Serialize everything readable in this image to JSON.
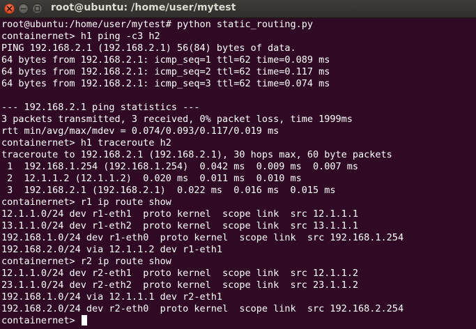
{
  "window": {
    "title": "root@ubuntu: /home/user/mytest"
  },
  "titlebar_icons": [
    "close-icon",
    "minimize-icon",
    "maximize-icon"
  ],
  "colors": {
    "terminal_background": "#300a24",
    "terminal_text": "#ffffff",
    "titlebar": "#3c3b37",
    "title_text": "#dfdbd2",
    "close_button": "#e2522b"
  },
  "terminal": {
    "lines": [
      "root@ubuntu:/home/user/mytest# python static_routing.py",
      "containernet> h1 ping -c3 h2",
      "PING 192.168.2.1 (192.168.2.1) 56(84) bytes of data.",
      "64 bytes from 192.168.2.1: icmp_seq=1 ttl=62 time=0.089 ms",
      "64 bytes from 192.168.2.1: icmp_seq=2 ttl=62 time=0.117 ms",
      "64 bytes from 192.168.2.1: icmp_seq=3 ttl=62 time=0.074 ms",
      "",
      "--- 192.168.2.1 ping statistics ---",
      "3 packets transmitted, 3 received, 0% packet loss, time 1999ms",
      "rtt min/avg/max/mdev = 0.074/0.093/0.117/0.019 ms",
      "containernet> h1 traceroute h2",
      "traceroute to 192.168.2.1 (192.168.2.1), 30 hops max, 60 byte packets",
      " 1  192.168.1.254 (192.168.1.254)  0.042 ms  0.009 ms  0.007 ms",
      " 2  12.1.1.2 (12.1.1.2)  0.020 ms  0.011 ms  0.010 ms",
      " 3  192.168.2.1 (192.168.2.1)  0.022 ms  0.016 ms  0.015 ms",
      "containernet> r1 ip route show",
      "12.1.1.0/24 dev r1-eth1  proto kernel  scope link  src 12.1.1.1",
      "13.1.1.0/24 dev r1-eth2  proto kernel  scope link  src 13.1.1.1",
      "192.168.1.0/24 dev r1-eth0  proto kernel  scope link  src 192.168.1.254",
      "192.168.2.0/24 via 12.1.1.2 dev r1-eth1",
      "containernet> r2 ip route show",
      "12.1.1.0/24 dev r2-eth1  proto kernel  scope link  src 12.1.1.2",
      "23.1.1.0/24 dev r2-eth2  proto kernel  scope link  src 23.1.1.2",
      "192.168.1.0/24 via 12.1.1.1 dev r2-eth1",
      "192.168.2.0/24 dev r2-eth0  proto kernel  scope link  src 192.168.2.254"
    ],
    "prompt": "containernet> "
  }
}
